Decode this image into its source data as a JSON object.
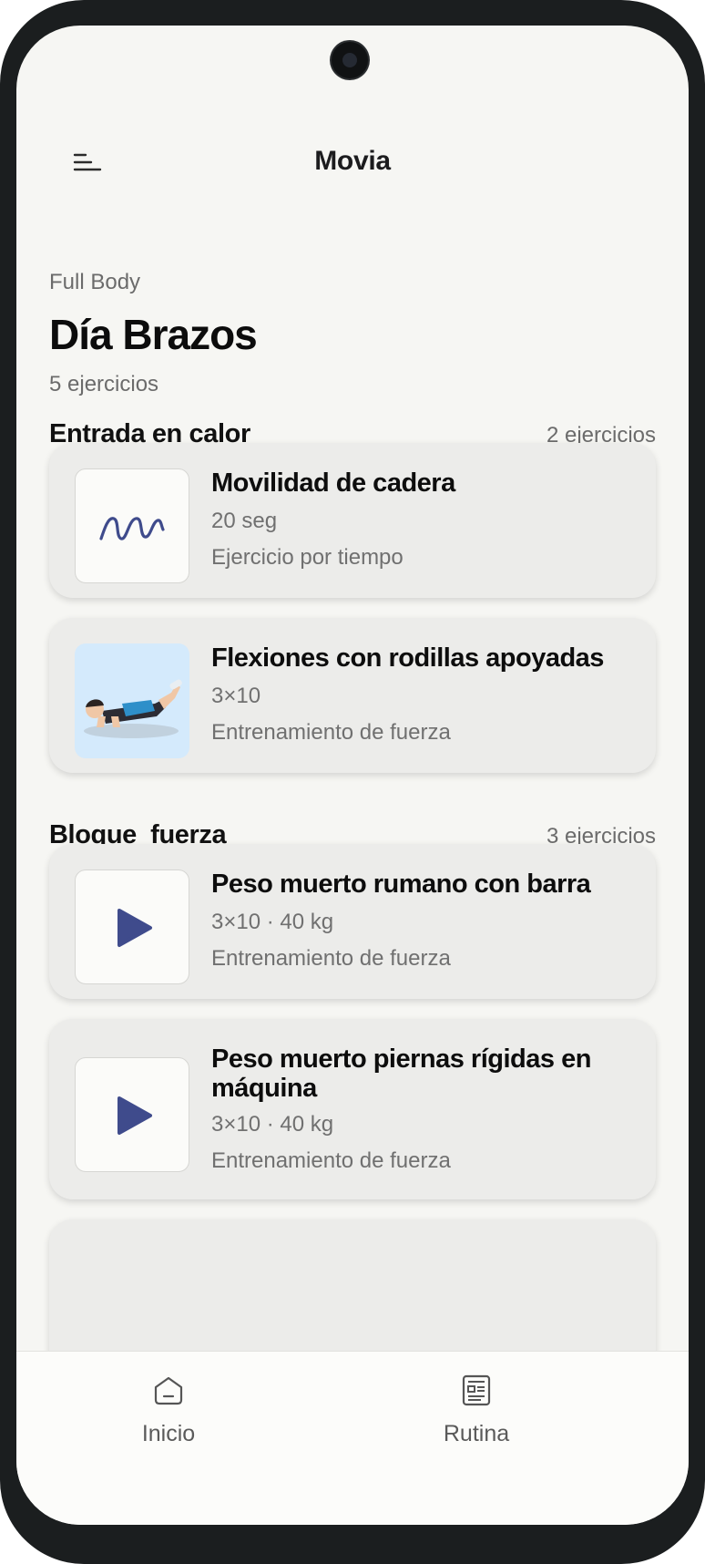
{
  "app": {
    "title": "Movia"
  },
  "routine": {
    "category": "Full Body",
    "title": "Día Brazos",
    "exercise_count": "5 ejercicios"
  },
  "sections": [
    {
      "title": "Entrada en calor",
      "count": "2 ejercicios",
      "exercises": [
        {
          "name": "Movilidad de cadera",
          "meta": "20 seg",
          "type": "Ejercicio por tiempo",
          "thumb": "squiggle-drawing"
        },
        {
          "name": "Flexiones con rodillas apoyadas",
          "meta": "3×10",
          "type": "Entrenamiento de fuerza",
          "thumb": "pushup-illustration"
        }
      ]
    },
    {
      "title": "Bloque  fuerza",
      "count": "3 ejercicios",
      "exercises": [
        {
          "name": "Peso muerto rumano con barra",
          "meta": "3×10 · 40 kg",
          "type": "Entrenamiento de fuerza",
          "thumb": "play-icon"
        },
        {
          "name": "Peso muerto piernas rígidas en máquina",
          "meta": "3×10 · 40 kg",
          "type": "Entrenamiento de fuerza",
          "thumb": "play-icon"
        }
      ]
    }
  ],
  "nav": {
    "home_label": "Inicio",
    "routine_label": "Rutina"
  },
  "colors": {
    "accent": "#3f4b8c",
    "background": "#f6f6f3",
    "card": "#ececea",
    "frame": "#1b1e1f"
  }
}
